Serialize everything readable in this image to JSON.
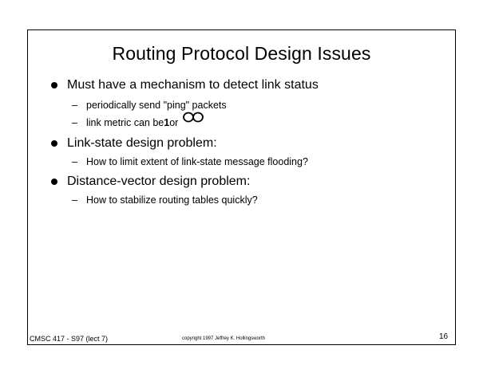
{
  "slide": {
    "title": "Routing Protocol Design Issues",
    "bullets": [
      {
        "text": "Must have a mechanism to detect link status",
        "subs": [
          {
            "text": "periodically send \"ping\" packets"
          },
          {
            "pre": "link metric can be ",
            "bold": "1",
            "post": " or",
            "symbol": "infinity-icon"
          }
        ]
      },
      {
        "text": "Link-state design problem:",
        "subs": [
          {
            "text": "How to limit extent of link-state message flooding?"
          }
        ]
      },
      {
        "text": "Distance-vector design problem:",
        "subs": [
          {
            "text": "How to stabilize routing tables quickly?"
          }
        ]
      }
    ],
    "sub_marker": "–"
  },
  "footer": {
    "course": "CMSC 417 - S97  (lect 7)",
    "copyright": "copyright 1997 Jeffrey K. Hollingsworth",
    "page_number": "16"
  }
}
